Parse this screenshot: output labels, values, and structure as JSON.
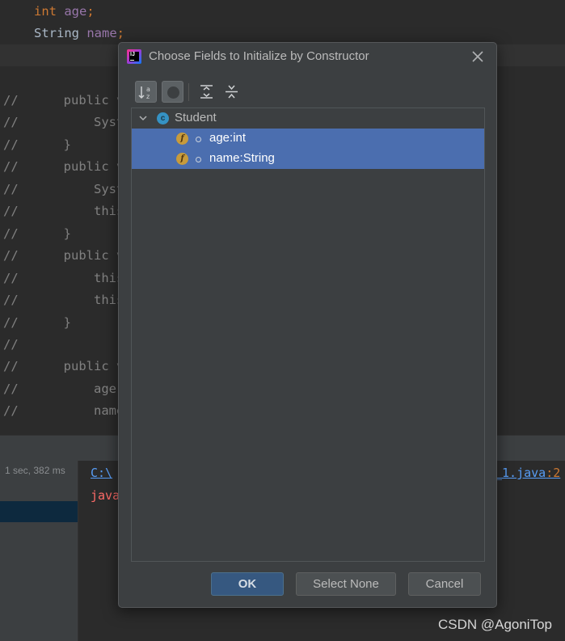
{
  "editor": {
    "top_lines": [
      {
        "kw": "int",
        "var": "age",
        "punct": ";"
      },
      {
        "kw": "String",
        "var": "name",
        "punct": ";"
      }
    ],
    "comment_lines": [
      {
        "cmt": "//",
        "code": "    public vo"
      },
      {
        "cmt": "//",
        "code": "        Syste"
      },
      {
        "cmt": "//",
        "code": "    }"
      },
      {
        "cmt": "//",
        "code": "    public vo"
      },
      {
        "cmt": "//",
        "code": "        Syste"
      },
      {
        "cmt": "//",
        "code": "        this"
      },
      {
        "cmt": "//",
        "code": "    }"
      },
      {
        "cmt": "//",
        "code": "    public vo"
      },
      {
        "cmt": "//",
        "code": "        this"
      },
      {
        "cmt": "//",
        "code": "        this"
      },
      {
        "cmt": "//",
        "code": "    }"
      },
      {
        "cmt": "//",
        "code": ""
      },
      {
        "cmt": "//",
        "code": "    public vo"
      },
      {
        "cmt": "//",
        "code": "        age ="
      },
      {
        "cmt": "//",
        "code": "        name"
      }
    ]
  },
  "run_panel": {
    "elapsed": "1 sec, 382 ms",
    "link_left": "C:\\",
    "link_right": "_1.java",
    "link_line": ":2",
    "error_text": "java"
  },
  "dialog": {
    "title": "Choose Fields to Initialize by Constructor",
    "toolbar": {
      "sort_icon": "sort-alphabetically-icon",
      "visibility_icon": "show-visibility-icon",
      "expand_icon": "expand-all-icon",
      "collapse_icon": "collapse-all-icon"
    },
    "tree": {
      "class_name": "Student",
      "class_icon_letter": "c",
      "field_icon_letter": "f",
      "fields": [
        {
          "label": "age:int",
          "selected": true
        },
        {
          "label": "name:String",
          "selected": true
        }
      ]
    },
    "buttons": {
      "ok": "OK",
      "select_none": "Select None",
      "cancel": "Cancel"
    }
  },
  "watermark": "CSDN @AgoniTop",
  "colors": {
    "selection": "#4b6eaf",
    "dialog_bg": "#3c3f41",
    "editor_bg": "#2b2b2b",
    "ok_button": "#365880"
  }
}
